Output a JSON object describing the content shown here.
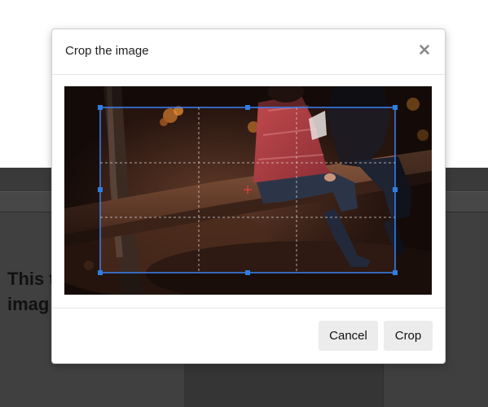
{
  "modal": {
    "title": "Crop the image",
    "close_icon": "close-icon",
    "cancel_label": "Cancel",
    "crop_label": "Crop"
  },
  "cropper": {
    "image": "photo of a couple sitting on a log in an autumn forest at night",
    "guides": "3x3 dashed grid",
    "handle_color": "#2f7ee0",
    "selection_color": "#3b82f6",
    "center_marker": "crosshair-icon"
  },
  "background_page": {
    "text": "This the le side, imag right."
  }
}
